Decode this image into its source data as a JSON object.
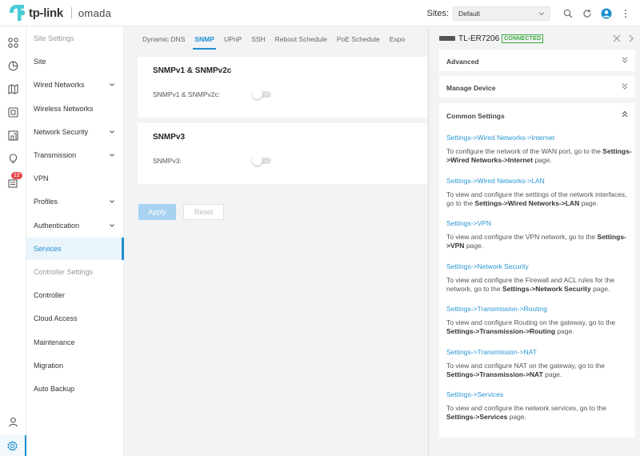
{
  "header": {
    "brand": "tp-link",
    "product": "omada",
    "sites_label": "Sites:",
    "site_value": "Default"
  },
  "rail": {
    "badge_count": "12"
  },
  "menu": {
    "items": [
      {
        "label": "Site Settings",
        "type": "header"
      },
      {
        "label": "Site"
      },
      {
        "label": "Wired Networks",
        "expandable": true
      },
      {
        "label": "Wireless Networks"
      },
      {
        "label": "Network Security",
        "expandable": true
      },
      {
        "label": "Transmission",
        "expandable": true
      },
      {
        "label": "VPN"
      },
      {
        "label": "Profiles",
        "expandable": true
      },
      {
        "label": "Authentication",
        "expandable": true
      },
      {
        "label": "Services",
        "active": true
      },
      {
        "label": "Controller Settings",
        "type": "header"
      },
      {
        "label": "Controller"
      },
      {
        "label": "Cloud Access"
      },
      {
        "label": "Maintenance"
      },
      {
        "label": "Migration"
      },
      {
        "label": "Auto Backup"
      }
    ]
  },
  "tabs": [
    {
      "label": "Dynamic DNS"
    },
    {
      "label": "SNMP",
      "active": true
    },
    {
      "label": "UPnP"
    },
    {
      "label": "SSH"
    },
    {
      "label": "Reboot Schedule"
    },
    {
      "label": "PoE Schedule"
    },
    {
      "label": "Expor"
    }
  ],
  "snmp_v1": {
    "title": "SNMPv1 & SNMPv2c",
    "field_label": "SNMPv1 & SNMPv2c:",
    "enabled": false
  },
  "snmp_v3": {
    "title": "SNMPv3",
    "field_label": "SNMPv3:",
    "enabled": false
  },
  "buttons": {
    "apply": "Apply",
    "reset": "Reset"
  },
  "device_panel": {
    "device_name": "TL-ER7206",
    "status": "CONNECTED",
    "status_color": "#3caa3c",
    "advanced": "Advanced",
    "manage_device": "Manage Device",
    "common_settings": "Common Settings",
    "items": [
      {
        "link": "Settings->Wired Networks->Internet",
        "desc_pre": "To configure the network of the WAN port, go to the ",
        "desc_bold": "Settings->Wired Networks->Internet",
        "desc_post": " page."
      },
      {
        "link": "Settings->Wired Networks->LAN",
        "desc_pre": "To view and configure the settings of the network interfaces, go to the ",
        "desc_bold": "Settings->Wired Networks->LAN",
        "desc_post": " page."
      },
      {
        "link": "Settings->VPN",
        "desc_pre": "To view and configure the VPN network, go to the ",
        "desc_bold": "Settings->VPN",
        "desc_post": " page."
      },
      {
        "link": "Settings->Network Security",
        "desc_pre": "To view and configure the Firewall and ACL rules for the network, go to the ",
        "desc_bold": "Settings->Network Security",
        "desc_post": " page."
      },
      {
        "link": "Settings->Transmission->Routing",
        "desc_pre": "To view and configure Routing on the gateway, go to the ",
        "desc_bold": "Settings->Transmission->Routing",
        "desc_post": " page."
      },
      {
        "link": "Settings->Transmission->NAT",
        "desc_pre": "To view and configure NAT on the gateway, go to the ",
        "desc_bold": "Settings->Transmission->NAT",
        "desc_post": " page."
      },
      {
        "link": "Settings->Services",
        "desc_pre": "To view and configure the network services, go to the ",
        "desc_bold": "Settings->Services",
        "desc_post": " page."
      }
    ]
  },
  "colors": {
    "accent": "#1f8fd1",
    "link": "#2a96d4",
    "badge": "#e8494b",
    "brand_teal": "#4acbd6"
  }
}
